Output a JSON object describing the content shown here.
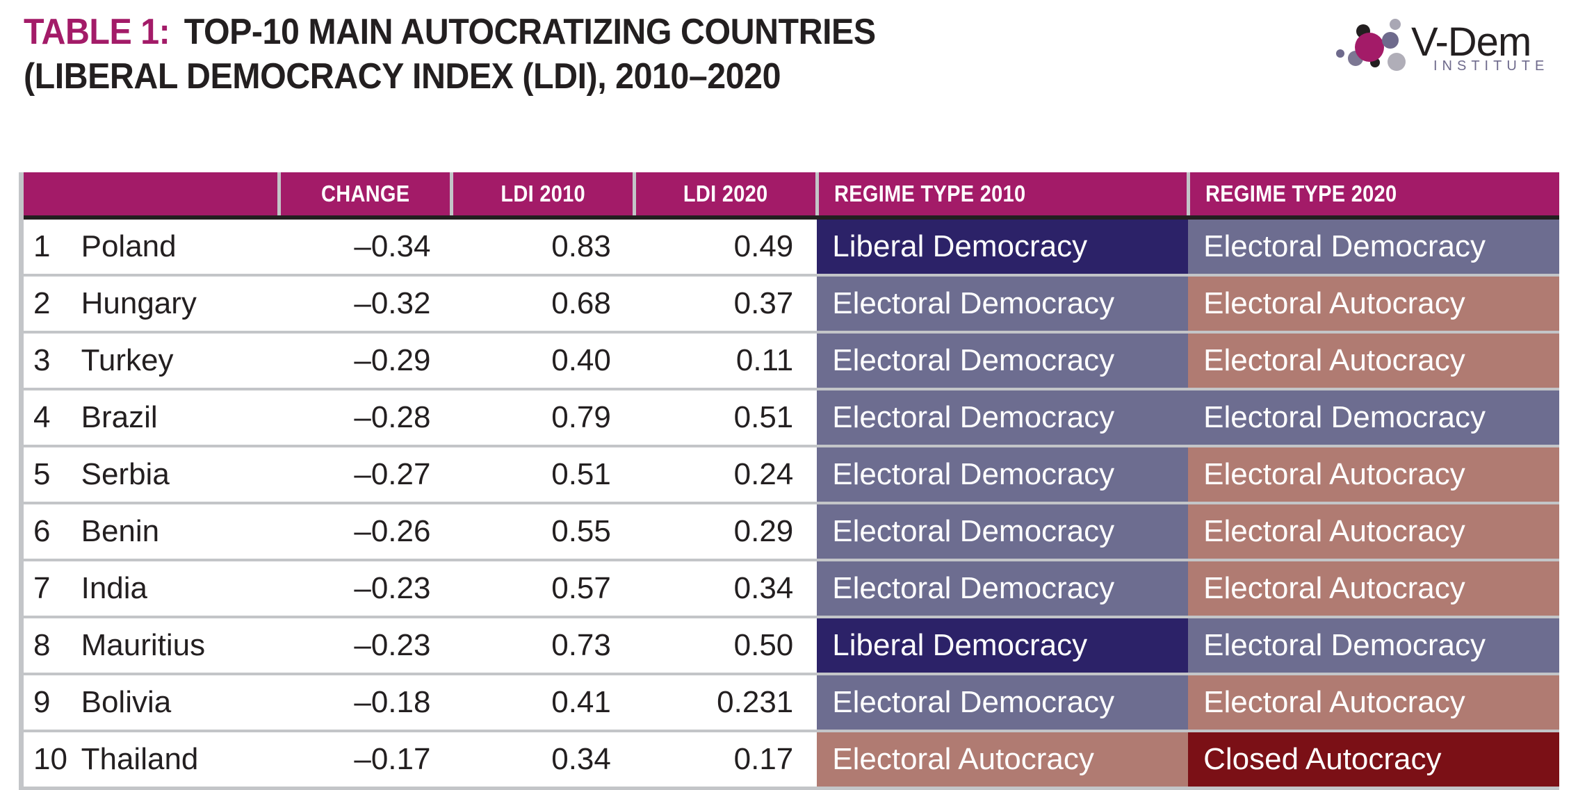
{
  "title": {
    "label": "TABLE 1:",
    "line1_rest": "TOP-10 MAIN AUTOCRATIZING COUNTRIES",
    "line2": "(LIBERAL DEMOCRACY INDEX (LDI), 2010–2020"
  },
  "logo": {
    "wordmark": "V-Dem",
    "subtitle": "INSTITUTE"
  },
  "colors": {
    "header_magenta": "#A31B68",
    "title_label": "#A31B68",
    "liberal_democracy": "#2C2268",
    "electoral_democracy": "#6D6D90",
    "electoral_autocracy": "#B07B72",
    "closed_autocracy": "#7B1016",
    "grid_gray": "#C3C5C8",
    "text_black": "#231F20"
  },
  "table": {
    "headers": {
      "blank": "",
      "change": "CHANGE",
      "ldi_2010": "LDI 2010",
      "ldi_2020": "LDI 2020",
      "regime_2010": "REGIME TYPE 2010",
      "regime_2020": "REGIME TYPE 2020"
    },
    "rows": [
      {
        "rank": "1",
        "country": "Poland",
        "change": "–0.34",
        "ldi_2010": "0.83",
        "ldi_2020": "0.49",
        "regime_2010": "Liberal Democracy",
        "regime_2010_class": "rg-liberal",
        "regime_2020": "Electoral Democracy",
        "regime_2020_class": "rg-electdem"
      },
      {
        "rank": "2",
        "country": "Hungary",
        "change": "–0.32",
        "ldi_2010": "0.68",
        "ldi_2020": "0.37",
        "regime_2010": "Electoral Democracy",
        "regime_2010_class": "rg-electdem",
        "regime_2020": "Electoral Autocracy",
        "regime_2020_class": "rg-electaut"
      },
      {
        "rank": "3",
        "country": "Turkey",
        "change": "–0.29",
        "ldi_2010": "0.40",
        "ldi_2020": "0.11",
        "regime_2010": "Electoral Democracy",
        "regime_2010_class": "rg-electdem",
        "regime_2020": "Electoral Autocracy",
        "regime_2020_class": "rg-electaut"
      },
      {
        "rank": "4",
        "country": "Brazil",
        "change": "–0.28",
        "ldi_2010": "0.79",
        "ldi_2020": "0.51",
        "regime_2010": "Electoral Democracy",
        "regime_2010_class": "rg-electdem",
        "regime_2020": "Electoral Democracy",
        "regime_2020_class": "rg-electdem"
      },
      {
        "rank": "5",
        "country": "Serbia",
        "change": "–0.27",
        "ldi_2010": "0.51",
        "ldi_2020": "0.24",
        "regime_2010": "Electoral Democracy",
        "regime_2010_class": "rg-electdem",
        "regime_2020": "Electoral Autocracy",
        "regime_2020_class": "rg-electaut"
      },
      {
        "rank": "6",
        "country": "Benin",
        "change": "–0.26",
        "ldi_2010": "0.55",
        "ldi_2020": "0.29",
        "regime_2010": "Electoral Democracy",
        "regime_2010_class": "rg-electdem",
        "regime_2020": "Electoral Autocracy",
        "regime_2020_class": "rg-electaut"
      },
      {
        "rank": "7",
        "country": "India",
        "change": "–0.23",
        "ldi_2010": "0.57",
        "ldi_2020": "0.34",
        "regime_2010": "Electoral Democracy",
        "regime_2010_class": "rg-electdem",
        "regime_2020": "Electoral Autocracy",
        "regime_2020_class": "rg-electaut"
      },
      {
        "rank": "8",
        "country": "Mauritius",
        "change": "–0.23",
        "ldi_2010": "0.73",
        "ldi_2020": "0.50",
        "regime_2010": "Liberal Democracy",
        "regime_2010_class": "rg-liberal",
        "regime_2020": "Electoral Democracy",
        "regime_2020_class": "rg-electdem"
      },
      {
        "rank": "9",
        "country": "Bolivia",
        "change": "–0.18",
        "ldi_2010": "0.41",
        "ldi_2020": "0.231",
        "regime_2010": "Electoral Democracy",
        "regime_2010_class": "rg-electdem",
        "regime_2020": "Electoral Autocracy",
        "regime_2020_class": "rg-electaut"
      },
      {
        "rank": "10",
        "country": "Thailand",
        "change": "–0.17",
        "ldi_2010": "0.34",
        "ldi_2020": "0.17",
        "regime_2010": "Electoral Autocracy",
        "regime_2010_class": "rg-electaut",
        "regime_2020": "Closed Autocracy",
        "regime_2020_class": "rg-closed"
      }
    ]
  }
}
